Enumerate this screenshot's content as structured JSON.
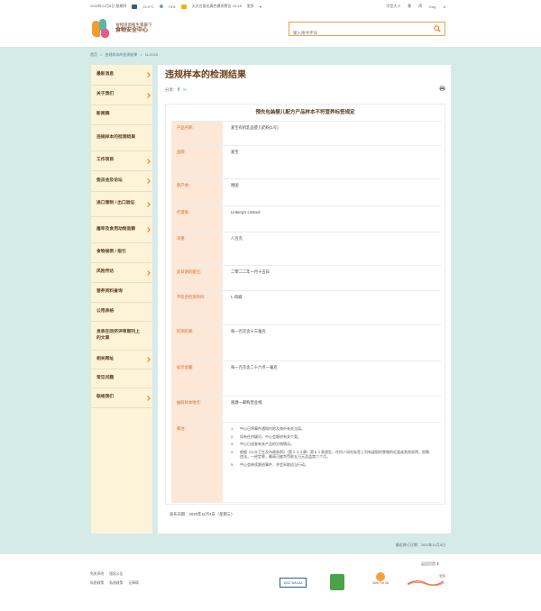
{
  "topbar": {
    "datetime": "2020年11月5日 星期四",
    "temp": "22.0°C",
    "humidity": "73%",
    "warning": "天文台發出黃色暴雨警告 10:18",
    "more": "更多",
    "lang_sc": "简",
    "lang_tc": "繁",
    "lang_size": "字型大小",
    "lang_en": "Eng"
  },
  "header": {
    "org_line1": "食物環境衞生署屬下",
    "org_line2": "食物安全中心",
    "search_placeholder": "输入搜寻字词"
  },
  "breadcrumb": [
    "首页",
    "违规样本的检测结果",
    "11-2020"
  ],
  "sidebar": {
    "items": [
      {
        "label": "最新消息",
        "chevron": true
      },
      {
        "label": "关于我们",
        "chevron": true
      },
      {
        "label": "新闻稿",
        "chevron": false
      },
      {
        "label": "违规样本的检测结果",
        "chevron": false
      },
      {
        "label": "工作项目",
        "chevron": true
      },
      {
        "label": "委员会及论坛",
        "chevron": true
      },
      {
        "label": "进口管制 / 出口验证",
        "chevron": true
      },
      {
        "label": "屠宰及食用动物监察",
        "chevron": true
      },
      {
        "label": "食物规例 / 指引",
        "chevron": false
      },
      {
        "label": "风险传达",
        "chevron": true
      },
      {
        "label": "营养资料查询",
        "chevron": false
      },
      {
        "label": "公用表格",
        "chevron": false
      },
      {
        "label": "发表在同侪评审期刊上的文章",
        "chevron": false
      },
      {
        "label": "相关网址",
        "chevron": true
      },
      {
        "label": "常见问题",
        "chevron": false
      },
      {
        "label": "联络我们",
        "chevron": true
      }
    ]
  },
  "page": {
    "title": "违规样本的检测结果",
    "share_label": "分享:",
    "notice_title": "预先包装婴儿配方产品样本不符营养标签规定"
  },
  "table": {
    "rows": [
      {
        "label": "产品名称:",
        "value": "爱宝有机乳品婴儿奶粉(1号)"
      },
      {
        "label": "品牌:",
        "value": "爱宝"
      },
      {
        "label": "原产地:",
        "value": "德国"
      },
      {
        "label": "代理商:",
        "value": "Linberg's Limited"
      },
      {
        "label": "净重:",
        "value": "八百克"
      },
      {
        "label": "此日期前最佳:",
        "value": "二零二二年一月十五日"
      },
      {
        "label": "不符合检测项目:",
        "value": "L-肉碱"
      },
      {
        "label": "检测结果:",
        "value": "每一百克含十三毫克"
      },
      {
        "label": "标示含量:",
        "value": "每一百克含二十六点一毫克"
      },
      {
        "label": "抽取样本地点:",
        "value": "观塘一邮购营业线"
      },
      {
        "label": "备注:",
        "value": ""
      }
    ],
    "notes": [
      "中心已将事件通知内地及海外有关当局。",
      "如有任何疑问，中心会跟进有关个案。",
      "中心已追查有关产品的分销情况。",
      "根据《公众卫生及市政条例》（第１３２章）第６１条规定，任何人如在标签上列有虚假的食物的近盖或其他说明，即属违法，一经定罪，最高可被判罚款五万元及监禁六个月。",
      "中心会继续跟进事件，并会采取适当行动。"
    ]
  },
  "posted": "发布日期：2020年11月4日（星期三）",
  "revised": "最近修订日期：2020年11月4日",
  "footer": {
    "back_top": "返回页首",
    "links_row1": [
      "免责声明",
      "版权公告"
    ],
    "links_row2": [
      "私隐政策",
      "私隐政策",
      "无障碍"
    ],
    "badge1": "WAI-AA",
    "badge2": "W3C",
    "badge3": "Web For All",
    "badge4": "全民"
  }
}
